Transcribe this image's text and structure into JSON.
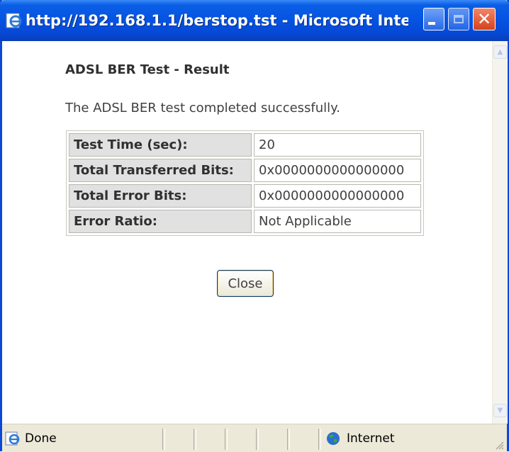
{
  "window": {
    "title": "http://192.168.1.1/berstop.tst - Microsoft Inte...",
    "titlebar_color": "#0554e3",
    "close_button_color": "#d4431b"
  },
  "content": {
    "heading": "ADSL BER Test - Result",
    "message": "The ADSL BER test completed successfully.",
    "rows": [
      {
        "label": "Test Time (sec):",
        "value": "20"
      },
      {
        "label": "Total Transferred Bits:",
        "value": "0x0000000000000000"
      },
      {
        "label": "Total Error Bits:",
        "value": "0x0000000000000000"
      },
      {
        "label": "Error Ratio:",
        "value": "Not Applicable"
      }
    ],
    "close_label": "Close"
  },
  "statusbar": {
    "status": "Done",
    "zone": "Internet",
    "icons": [
      "ie-page-icon",
      "globe-icon"
    ]
  }
}
